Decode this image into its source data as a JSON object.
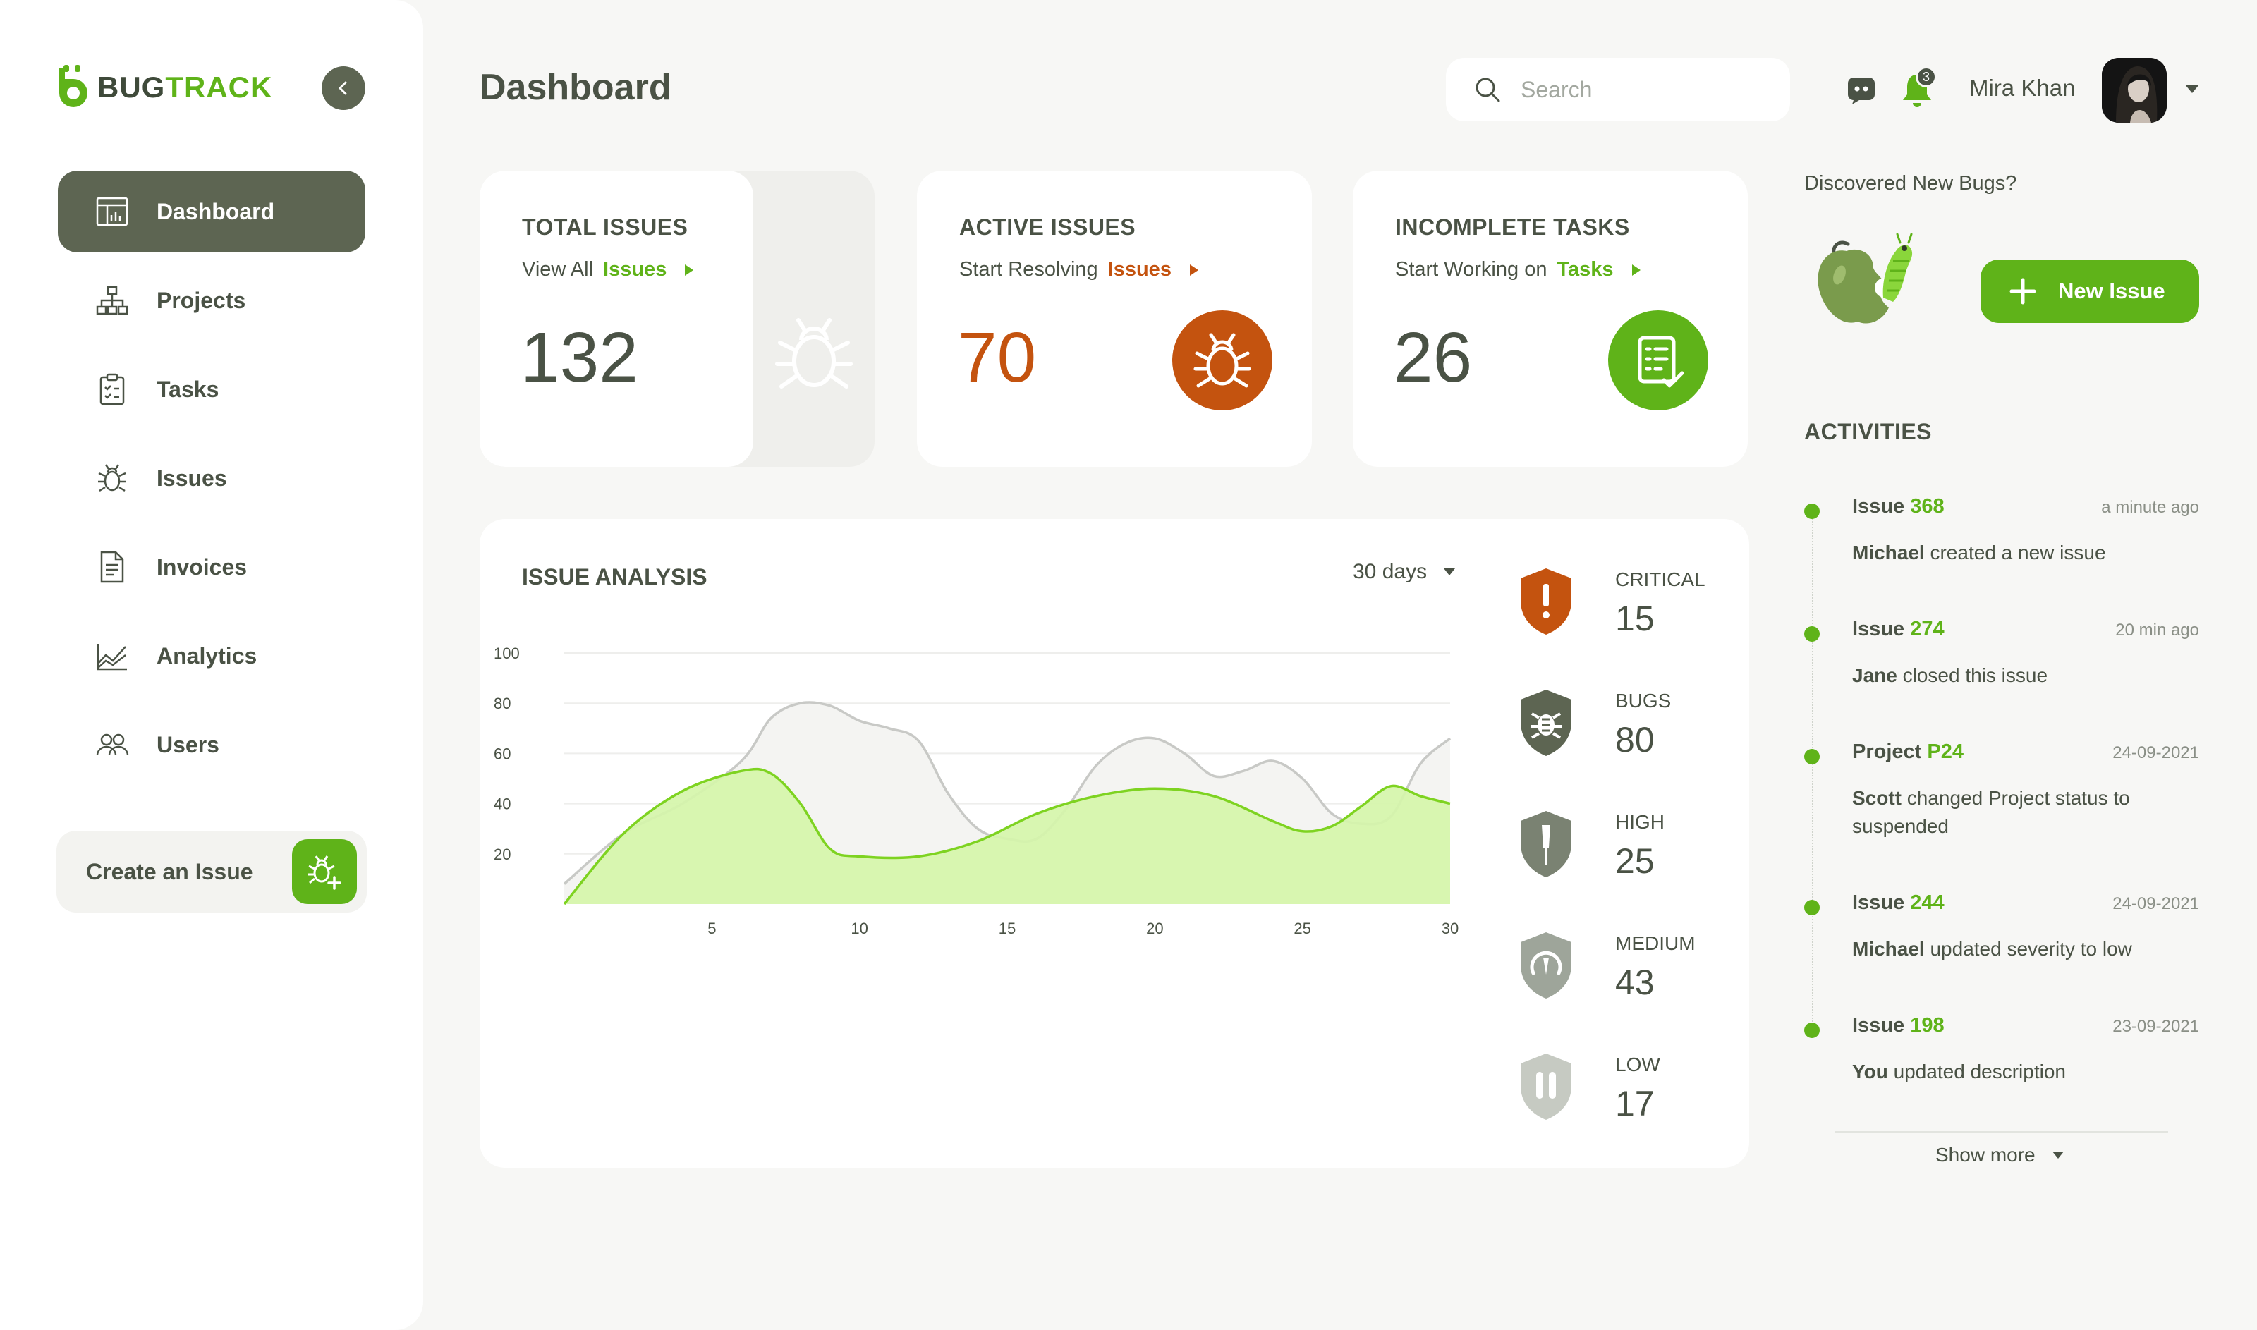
{
  "app": {
    "logo_primary": "BUG",
    "logo_secondary": "TRACK",
    "brand_color": "#5fb319",
    "dark_color": "#5d6552",
    "accent_orange": "#c4530f"
  },
  "sidebar": {
    "items": [
      {
        "label": "Dashboard",
        "icon": "dashboard-icon",
        "active": true
      },
      {
        "label": "Projects",
        "icon": "sitemap-icon",
        "active": false
      },
      {
        "label": "Tasks",
        "icon": "clipboard-icon",
        "active": false
      },
      {
        "label": "Issues",
        "icon": "bug-icon",
        "active": false
      },
      {
        "label": "Invoices",
        "icon": "document-icon",
        "active": false
      },
      {
        "label": "Analytics",
        "icon": "chart-icon",
        "active": false
      },
      {
        "label": "Users",
        "icon": "users-icon",
        "active": false
      }
    ],
    "create_issue_label": "Create an Issue"
  },
  "header": {
    "title": "Dashboard",
    "search_placeholder": "Search",
    "notification_count": "3",
    "user_name": "Mira Khan"
  },
  "stats": {
    "total": {
      "title": "TOTAL ISSUES",
      "sub_prefix": "View All",
      "link": "Issues",
      "value": "132"
    },
    "active": {
      "title": "ACTIVE ISSUES",
      "sub_prefix": "Start Resolving",
      "link": "Issues",
      "value": "70"
    },
    "incomplete": {
      "title": "INCOMPLETE TASKS",
      "sub_prefix": "Start Working on",
      "link": "Tasks",
      "value": "26"
    }
  },
  "analysis": {
    "title": "ISSUE ANALYSIS",
    "range": "30 days",
    "severity": [
      {
        "name": "CRITICAL",
        "value": "15",
        "color": "#c4530f",
        "icon": "alert-shield-icon"
      },
      {
        "name": "BUGS",
        "value": "80",
        "color": "#5d6552",
        "icon": "bug-shield-icon"
      },
      {
        "name": "HIGH",
        "value": "25",
        "color": "#7a8272",
        "icon": "high-shield-icon"
      },
      {
        "name": "MEDIUM",
        "value": "43",
        "color": "#9ea59a",
        "icon": "medium-shield-icon"
      },
      {
        "name": "LOW",
        "value": "17",
        "color": "#c6cac2",
        "icon": "low-shield-icon"
      }
    ]
  },
  "chart_data": {
    "type": "area",
    "x_ticks": [
      5,
      10,
      15,
      20,
      25,
      30
    ],
    "y_ticks": [
      20,
      40,
      60,
      80,
      100
    ],
    "xlim": [
      0,
      30
    ],
    "ylim": [
      0,
      100
    ],
    "grid": true,
    "series": [
      {
        "color": "#d5f5aa",
        "x": [
          0,
          2,
          4,
          6,
          7,
          8,
          9,
          10,
          12,
          14,
          16,
          18,
          20,
          22,
          24,
          25,
          26,
          27,
          28,
          29,
          30
        ],
        "values": [
          0,
          28,
          45,
          53,
          52,
          40,
          22,
          19,
          19,
          25,
          36,
          43,
          46,
          43,
          33,
          29,
          31,
          39,
          47,
          43,
          40
        ]
      },
      {
        "color": "#f4f4f2",
        "x": [
          0,
          2,
          4,
          6,
          7,
          8,
          9,
          10,
          11,
          12,
          13,
          14,
          15,
          16,
          17,
          18,
          19,
          20,
          21,
          22,
          23,
          24,
          25,
          26,
          27,
          28,
          29,
          30
        ],
        "values": [
          8,
          28,
          40,
          57,
          74,
          80,
          79,
          73,
          70,
          65,
          44,
          30,
          26,
          26,
          38,
          55,
          64,
          66,
          60,
          51,
          53,
          57,
          50,
          36,
          32,
          35,
          56,
          66
        ]
      }
    ]
  },
  "right": {
    "discover_text": "Discovered New Bugs?",
    "new_issue_label": "New Issue",
    "activities_title": "ACTIVITIES",
    "activities": [
      {
        "type": "Issue",
        "id": "368",
        "time": "a minute ago",
        "actor": "Michael",
        "action": "created a new issue"
      },
      {
        "type": "Issue",
        "id": "274",
        "time": "20 min ago",
        "actor": "Jane",
        "action": "closed this issue"
      },
      {
        "type": "Project",
        "id": "P24",
        "time": "24-09-2021",
        "actor": "Scott",
        "action": "changed Project status to suspended"
      },
      {
        "type": "Issue",
        "id": "244",
        "time": "24-09-2021",
        "actor": "Michael",
        "action": "updated severity to low"
      },
      {
        "type": "Issue",
        "id": "198",
        "time": "23-09-2021",
        "actor": "You",
        "action": "updated description"
      }
    ],
    "show_more_label": "Show more"
  }
}
